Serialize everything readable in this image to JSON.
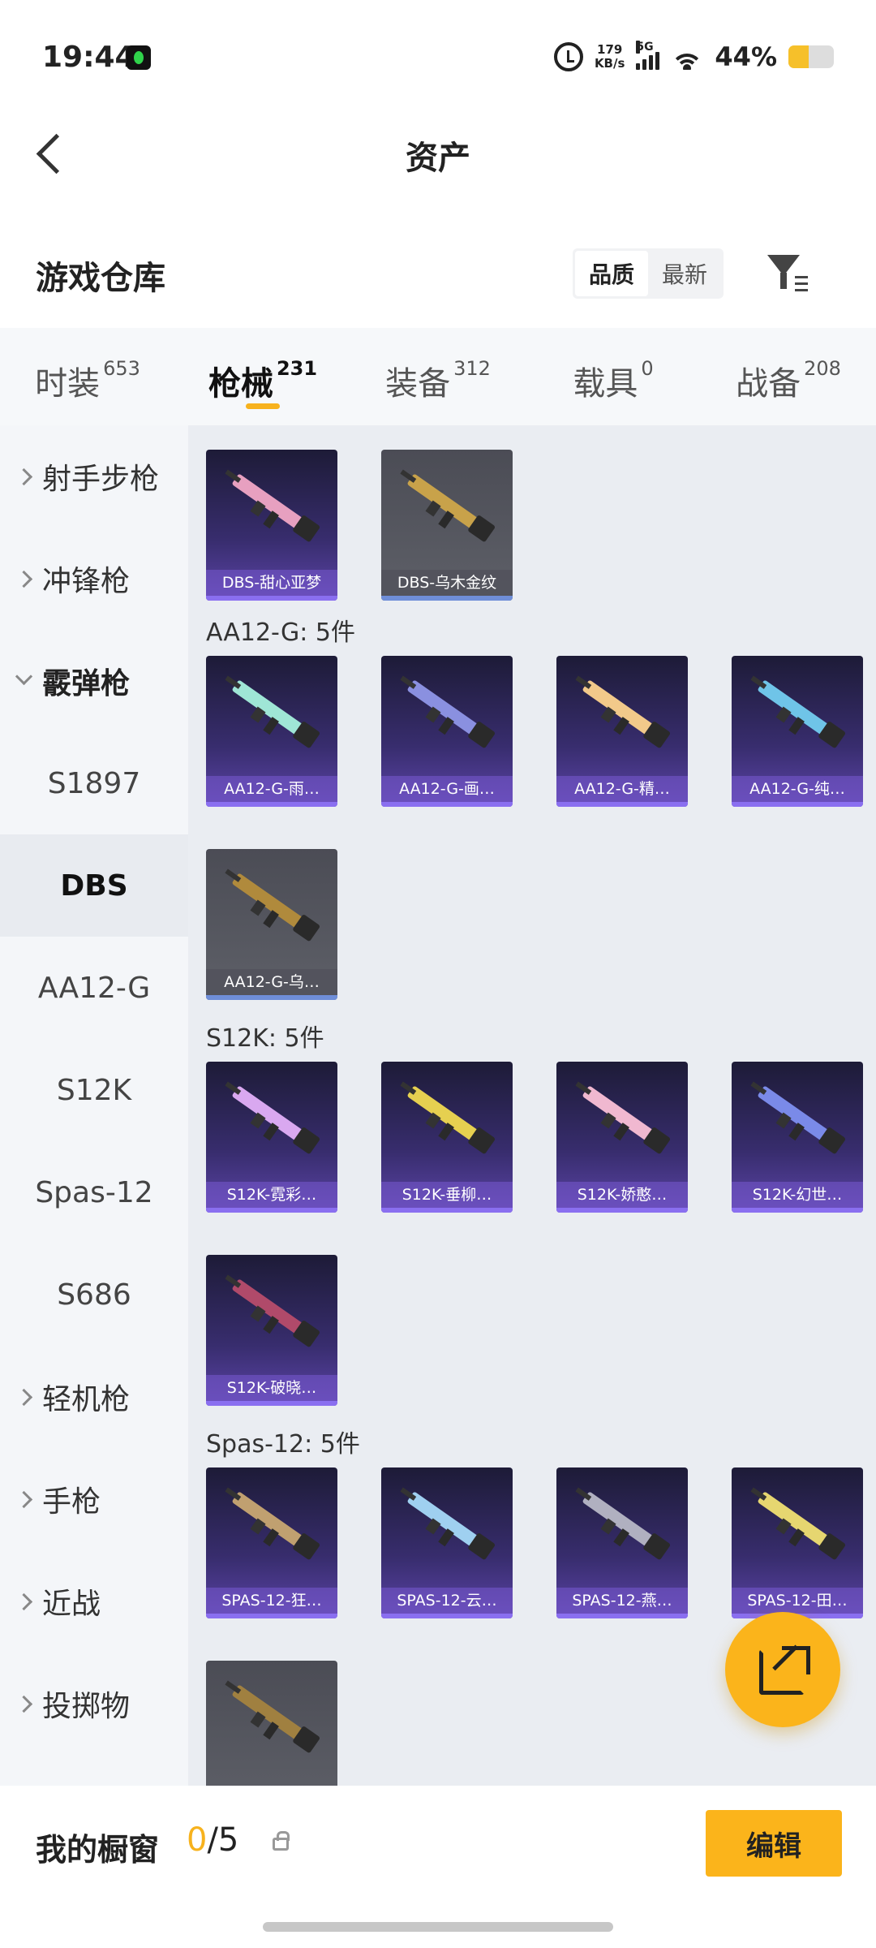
{
  "status_bar": {
    "time": "19:44",
    "net_speed": "179",
    "net_unit": "KB/s",
    "network": "5G",
    "battery_pct": "44%",
    "battery_level": 0.44
  },
  "nav": {
    "title": "资产"
  },
  "subheader": {
    "title": "游戏仓库",
    "sort_options": [
      "品质",
      "最新"
    ],
    "sort_selected": "品质"
  },
  "tabs": [
    {
      "label": "时装",
      "count": "653"
    },
    {
      "label": "枪械",
      "count": "231"
    },
    {
      "label": "装备",
      "count": "312"
    },
    {
      "label": "载具",
      "count": "0"
    },
    {
      "label": "战备",
      "count": "208"
    }
  ],
  "active_tab": "枪械",
  "sidebar": [
    {
      "label": "射手步枪",
      "kind": "group"
    },
    {
      "label": "冲锋枪",
      "kind": "group"
    },
    {
      "label": "霰弹枪",
      "kind": "open"
    },
    {
      "label": "S1897",
      "kind": "sub"
    },
    {
      "label": "DBS",
      "kind": "selected"
    },
    {
      "label": "AA12-G",
      "kind": "sub"
    },
    {
      "label": "S12K",
      "kind": "sub"
    },
    {
      "label": "Spas-12",
      "kind": "sub"
    },
    {
      "label": "S686",
      "kind": "sub"
    },
    {
      "label": "轻机枪",
      "kind": "group"
    },
    {
      "label": "手枪",
      "kind": "group"
    },
    {
      "label": "近战",
      "kind": "group"
    },
    {
      "label": "投掷物",
      "kind": "group"
    }
  ],
  "groups": [
    {
      "title": "",
      "items": [
        {
          "name": "DBS-甜心亚梦",
          "style": "purple"
        },
        {
          "name": "DBS-乌木金纹",
          "style": "gray"
        }
      ]
    },
    {
      "title": "AA12-G: 5件",
      "items": [
        {
          "name": "AA12-G-雨…",
          "style": "purple"
        },
        {
          "name": "AA12-G-画…",
          "style": "purple"
        },
        {
          "name": "AA12-G-精…",
          "style": "purple"
        },
        {
          "name": "AA12-G-纯…",
          "style": "purple"
        },
        {
          "name": "AA12-G-乌…",
          "style": "gray"
        }
      ]
    },
    {
      "title": "S12K: 5件",
      "items": [
        {
          "name": "S12K-霓彩…",
          "style": "purple"
        },
        {
          "name": "S12K-垂柳…",
          "style": "purple"
        },
        {
          "name": "S12K-娇憨…",
          "style": "purple"
        },
        {
          "name": "S12K-幻世…",
          "style": "purple"
        },
        {
          "name": "S12K-破晓…",
          "style": "purple"
        }
      ]
    },
    {
      "title": "Spas-12: 5件",
      "items": [
        {
          "name": "SPAS-12-狂…",
          "style": "purple"
        },
        {
          "name": "SPAS-12-云…",
          "style": "purple"
        },
        {
          "name": "SPAS-12-燕…",
          "style": "purple"
        },
        {
          "name": "SPAS-12-田…",
          "style": "purple"
        },
        {
          "name": "",
          "style": "gray"
        }
      ]
    }
  ],
  "bottom": {
    "label": "我的橱窗",
    "current": "0",
    "total": "/5",
    "edit_label": "编辑"
  },
  "colors": {
    "accent": "#fbb41b",
    "active_indicator": "#f7b21d"
  }
}
